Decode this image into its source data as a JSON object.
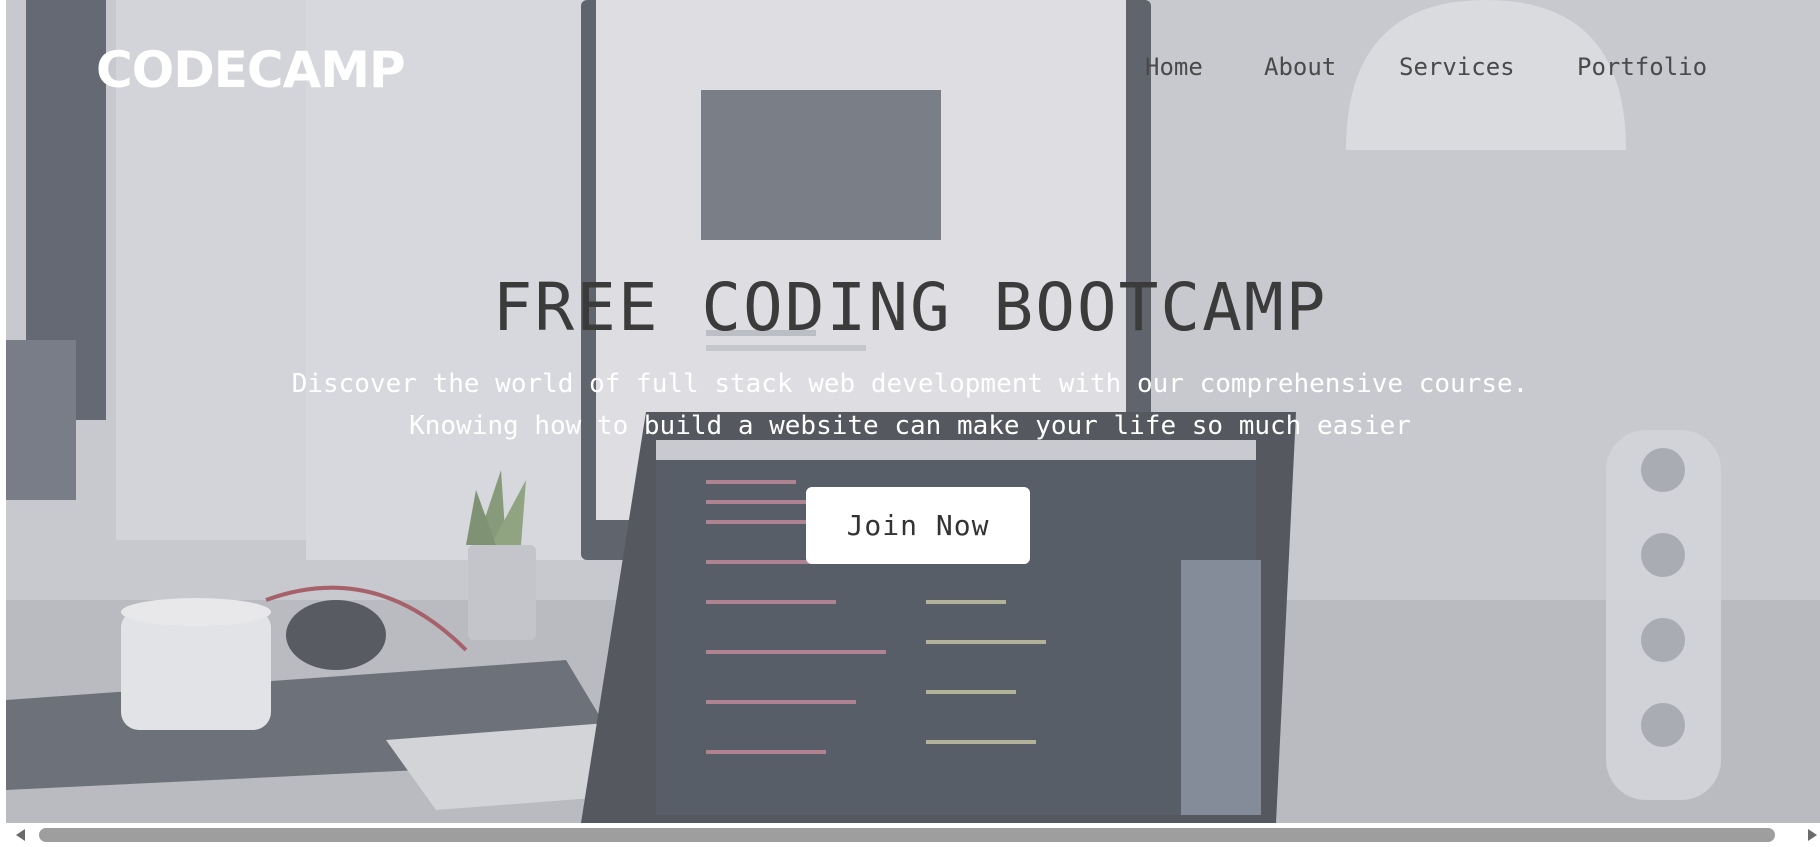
{
  "header": {
    "logo": "CODECAMP",
    "nav": [
      {
        "label": "Home"
      },
      {
        "label": "About"
      },
      {
        "label": "Services"
      },
      {
        "label": "Portfolio"
      }
    ]
  },
  "hero": {
    "title": "FREE CODING BOOTCAMP",
    "subtitle_line1": "Discover the world of full stack web development with our comprehensive course.",
    "subtitle_line2": "Knowing how to build a website can make your life so much easier",
    "cta_label": "Join Now",
    "background_image": "desk-laptop-monitor-photo"
  },
  "colors": {
    "title": "#3b3b3b",
    "subtitle": "#ffffff",
    "logo": "#ffffff",
    "nav": "#4a4a4a",
    "button_bg": "#ffffff",
    "button_text": "#333333",
    "overlay": "#c4c7ce"
  },
  "scrollbar": {
    "orientation": "horizontal",
    "left_icon": "triangle-left-icon",
    "right_icon": "triangle-right-icon"
  }
}
